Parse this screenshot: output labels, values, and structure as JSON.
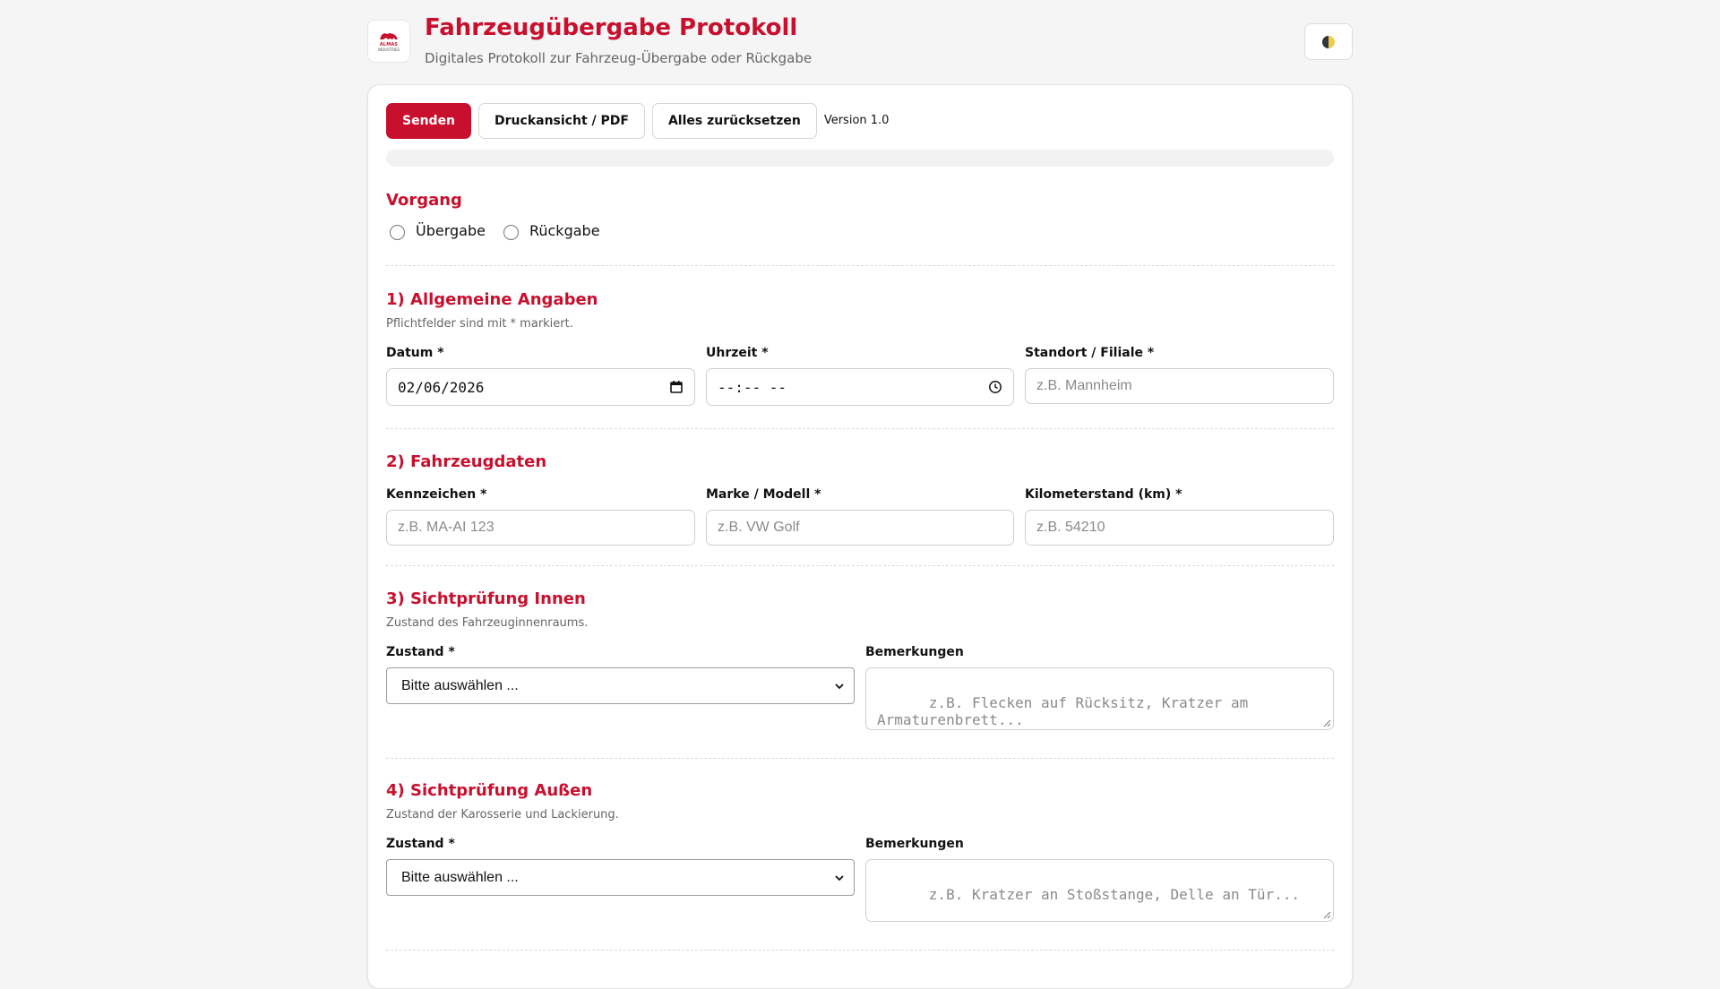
{
  "header": {
    "title": "Fahrzeugübergabe Protokoll",
    "subtitle": "Digitales Protokoll zur Fahrzeug-Übergabe oder Rückgabe",
    "logo_text": "ALMAS",
    "logo_subtext": "INDUSTRIES",
    "theme_toggle_icon": "contrast-icon"
  },
  "toolbar": {
    "send_label": "Senden",
    "print_label": "Druckansicht / PDF",
    "reset_label": "Alles zurücksetzen",
    "version": "Version 1.0"
  },
  "progress": {
    "value": 0
  },
  "vorgang": {
    "title": "Vorgang",
    "options": [
      "Übergabe",
      "Rückgabe"
    ],
    "selected": null
  },
  "allgemein": {
    "title": "1) Allgemeine Angaben",
    "hint": "Pflichtfelder sind mit * markiert.",
    "datum_label": "Datum *",
    "datum_value": "02/06/2026",
    "uhrzeit_label": "Uhrzeit *",
    "uhrzeit_value": "--:-- --",
    "standort_label": "Standort / Filiale *",
    "standort_placeholder": "z.B. Mannheim"
  },
  "fahrzeug": {
    "title": "2) Fahrzeugdaten",
    "kennzeichen_label": "Kennzeichen *",
    "kennzeichen_placeholder": "z.B. MA-AI 123",
    "marke_label": "Marke / Modell *",
    "marke_placeholder": "z.B. VW Golf",
    "km_label": "Kilometerstand (km) *",
    "km_placeholder": "z.B. 54210"
  },
  "innen": {
    "title": "3) Sichtprüfung Innen",
    "hint": "Zustand des Fahrzeuginnenraums.",
    "zustand_label": "Zustand *",
    "zustand_selected": "Bitte auswählen ...",
    "bemerkungen_label": "Bemerkungen",
    "bemerkungen_placeholder": "z.B. Flecken auf Rücksitz, Kratzer am Armaturenbrett..."
  },
  "aussen": {
    "title": "4) Sichtprüfung Außen",
    "hint": "Zustand der Karosserie und Lackierung.",
    "zustand_label": "Zustand *",
    "zustand_selected": "Bitte auswählen ...",
    "bemerkungen_label": "Bemerkungen",
    "bemerkungen_placeholder": "z.B. Kratzer an Stoßstange, Delle an Tür..."
  },
  "colors": {
    "accent": "#c8102e",
    "background": "#f5f5f5"
  }
}
